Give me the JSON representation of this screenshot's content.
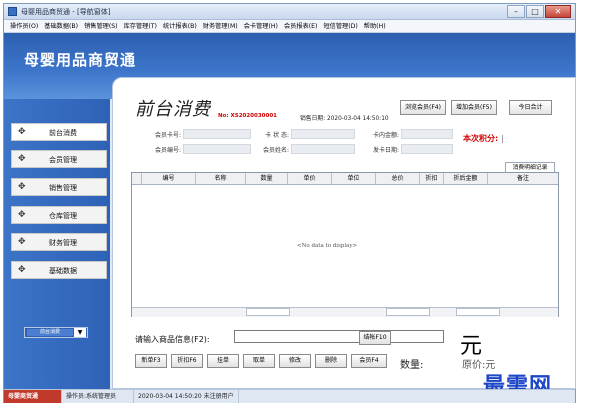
{
  "window": {
    "title": "母婴用品商贸通 - [导航窗体]",
    "controls": [
      "–",
      "□",
      "✕"
    ]
  },
  "menu": [
    "操作员(O)",
    "基础数据(B)",
    "销售管理(S)",
    "库存管理(T)",
    "统计报表(B)",
    "财务管理(M)",
    "会卡管理(H)",
    "会员报表(E)",
    "短信管理(D)",
    "帮助(H)"
  ],
  "app_title": "母婴用品商贸通",
  "sidebar": {
    "items": [
      {
        "label": "前台消费",
        "icon": "pin-icon"
      },
      {
        "label": "会员管理",
        "icon": "pin-icon"
      },
      {
        "label": "销售管理",
        "icon": "pin-icon"
      },
      {
        "label": "仓库管理",
        "icon": "pin-icon"
      },
      {
        "label": "财务管理",
        "icon": "pin-icon"
      },
      {
        "label": "基础数据",
        "icon": "pin-icon"
      }
    ],
    "combo_value": "前台消费"
  },
  "main": {
    "title": "前台消费",
    "order_no": "No: XS2020030001",
    "sale_date_label": "销售日期:",
    "sale_date": "2020-03-04 14:50:10",
    "buttons": {
      "browse": "浏览会员(F4)",
      "add_member": "增加会员(F5)",
      "today_total": "今日合计"
    },
    "form": {
      "card_no_label": "会员卡号:",
      "status_label": "卡 状 态:",
      "balance_label": "卡内金额:",
      "member_no_label": "会员编号:",
      "member_name_label": "会员姓名:",
      "issue_date_label": "发卡日期:",
      "points_label": "本次积分:"
    },
    "detail_tab": "消费明细记录",
    "grid": {
      "columns": [
        "编号",
        "名称",
        "数量",
        "单价",
        "单位",
        "总价",
        "折扣",
        "折后金额",
        "备注"
      ],
      "empty_text": "<No data to display>"
    },
    "input_label": "请输入商品信息(F2):",
    "input_value": "",
    "locate_button": "结帐F10",
    "bottom_buttons": [
      "新单F3",
      "折扣F6",
      "挂单",
      "取单",
      "修改",
      "删除",
      "会员F4"
    ],
    "yuan": "元",
    "qty_label": "数量:",
    "price_label": "原价:元",
    "watermark": "最需网"
  },
  "statusbar": [
    "母婴商贸通",
    "操作员:系统管理员",
    "2020-03-04 14:50:20 未注册用户"
  ]
}
